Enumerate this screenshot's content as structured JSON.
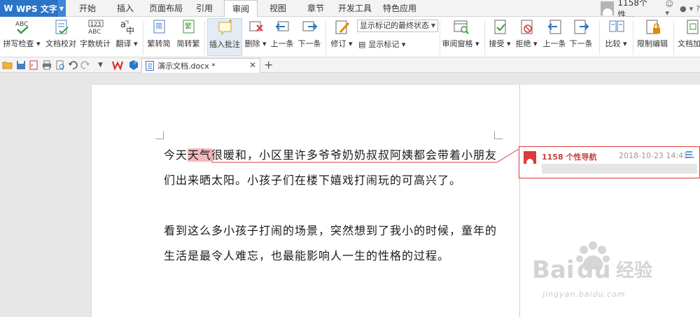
{
  "app": {
    "name": "WPS 文字"
  },
  "menu": {
    "tabs": [
      {
        "label": "开始"
      },
      {
        "label": "插入"
      },
      {
        "label": "页面布局"
      },
      {
        "label": "引用"
      },
      {
        "label": "审阅",
        "active": true
      },
      {
        "label": "视图"
      },
      {
        "label": "章节"
      },
      {
        "label": "开发工具"
      },
      {
        "label": "特色应用"
      }
    ],
    "user": "1158个性..."
  },
  "ribbon": {
    "spell_check": "拼写检查",
    "doc_proof": "文档校对",
    "word_count": "字数统计",
    "translate": "翻译",
    "to_simplified": "繁转简",
    "to_traditional": "简转繁",
    "insert_comment": "插入批注",
    "delete": "删除",
    "prev": "上一条",
    "next": "下一条",
    "track_changes": "修订",
    "markup_mode": "显示标记的最终状态",
    "show_markup": "显示标记",
    "review_pane": "审阅窗格",
    "accept": "接受",
    "reject": "拒绝",
    "prev2": "上一条",
    "next2": "下一条",
    "compare": "比较",
    "restrict_edit": "限制编辑",
    "doc_encrypt": "文档加"
  },
  "document": {
    "tab_title": "演示文档.docx *",
    "para1_line1_a": "今天",
    "para1_line1_hl": "天气",
    "para1_line1_b": "很暖和，小区里许多爷爷奶奶叔叔阿姨都会带着小朋友",
    "para1_line2": "们出来晒太阳。小孩子们在楼下嬉戏打闹玩的可高兴了。",
    "para2_line1": "看到这么多小孩子打闹的场景，突然想到了我小的时候，童年的",
    "para2_line2": "生活是最令人难忘，也最能影响人一生的性格的过程。"
  },
  "comment": {
    "author": "1158 个性导航",
    "time": "2018-10-23 14:41",
    "body": ""
  },
  "watermark": {
    "brand": "Bai 经验",
    "url": "jingyan.baidu.com"
  },
  "colors": {
    "brand_blue": "#2c74c7",
    "comment_red": "#dc3b3b",
    "highlight": "#f3b9bd"
  }
}
